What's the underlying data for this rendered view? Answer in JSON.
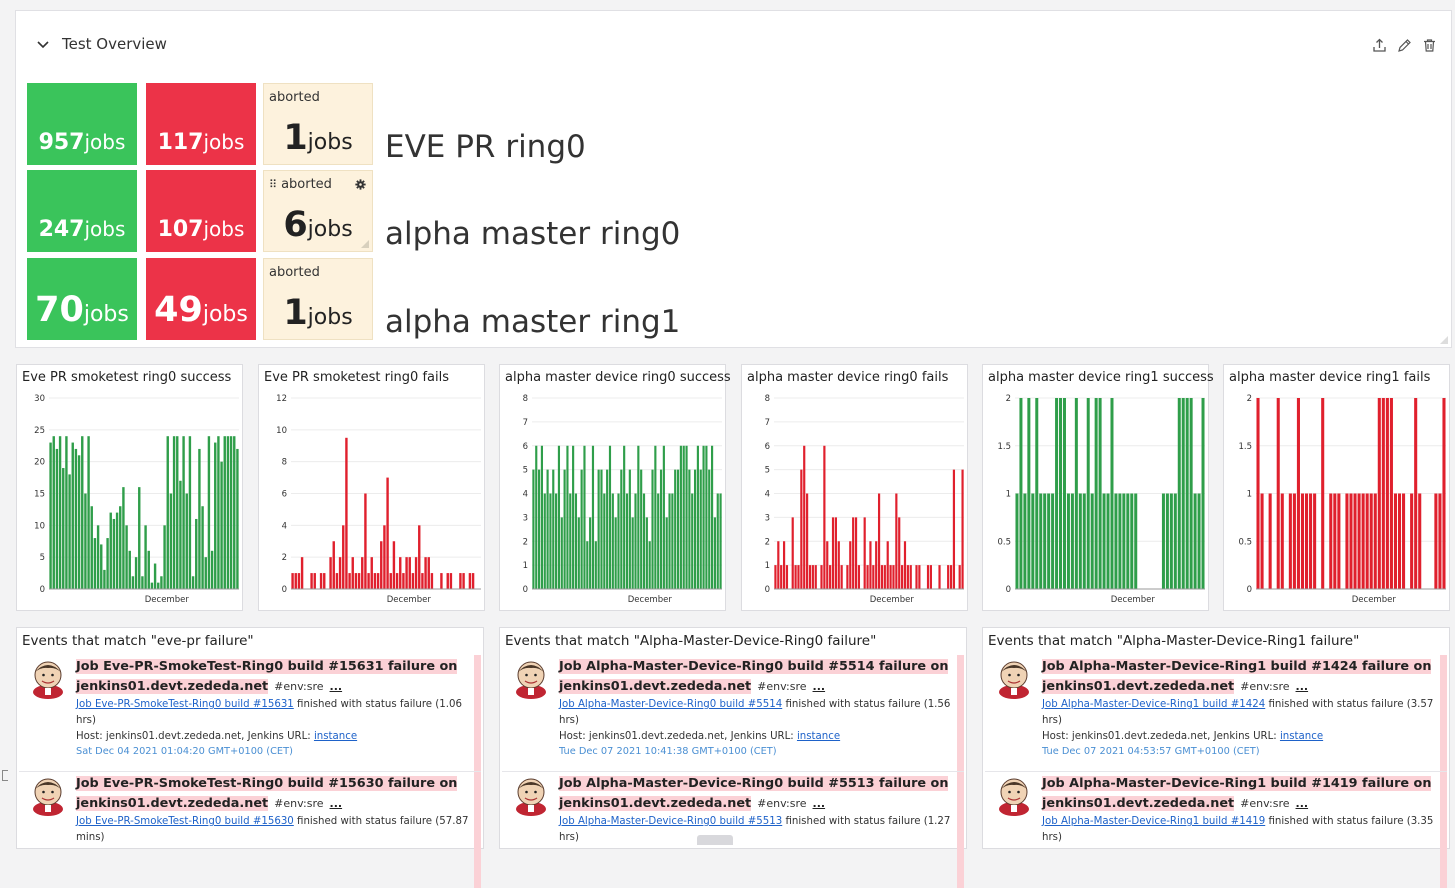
{
  "group": {
    "title": "Test Overview",
    "action_icons": [
      "export-icon",
      "edit-icon",
      "trash-icon"
    ]
  },
  "rows": [
    {
      "success": "957",
      "fails": "117",
      "aborted_label": "aborted",
      "aborted": "1",
      "unit": "jobs",
      "name": "EVE PR ring0"
    },
    {
      "success": "247",
      "fails": "107",
      "aborted_label": "aborted",
      "aborted": "6",
      "unit": "jobs",
      "name": "alpha master ring0"
    },
    {
      "success": "70",
      "fails": "49",
      "aborted_label": "aborted",
      "aborted": "1",
      "unit": "jobs",
      "name": "alpha master ring1"
    }
  ],
  "colors": {
    "success": "#3ac45b",
    "fail": "#ec3348",
    "aborted_bg": "#fdf2dd",
    "green_bar": "#2f9e4a",
    "red_bar": "#e0202d"
  },
  "chart_data": [
    {
      "type": "bar",
      "title": "Eve PR smoketest ring0 success",
      "ylim": [
        0,
        30
      ],
      "yticks": [
        0,
        5,
        10,
        15,
        20,
        25,
        30
      ],
      "x_tick": "December",
      "color": "#2f9e4a",
      "values": [
        23,
        24,
        22,
        24,
        19,
        24,
        18,
        23,
        22,
        21,
        24,
        15,
        24,
        13,
        8,
        10,
        7,
        3,
        8,
        12,
        11,
        12,
        13,
        16,
        10,
        6,
        2,
        5,
        16,
        2,
        10,
        6,
        1,
        4,
        1,
        2,
        10,
        24,
        15,
        24,
        24,
        17,
        24,
        15,
        24,
        2,
        11,
        22,
        13,
        5,
        24,
        6,
        23,
        24,
        20,
        24,
        24,
        24,
        24,
        22
      ]
    },
    {
      "type": "bar",
      "title": "Eve PR smoketest ring0 fails",
      "ylim": [
        0,
        12
      ],
      "yticks": [
        0,
        2,
        4,
        6,
        8,
        10,
        12
      ],
      "x_tick": "December",
      "color": "#e0202d",
      "values": [
        1,
        1,
        1,
        2,
        0,
        0,
        1,
        1,
        0,
        1,
        1,
        0,
        2,
        3,
        1,
        2,
        4,
        9.5,
        1,
        2,
        1,
        1,
        2,
        6,
        1,
        2,
        1,
        1,
        3,
        4,
        7,
        1,
        3,
        1,
        2,
        1,
        2,
        2,
        1,
        2,
        4,
        1,
        2,
        2,
        1,
        0,
        0,
        1,
        0,
        1,
        1,
        0,
        0,
        1,
        1,
        0,
        1,
        1,
        0,
        0
      ]
    },
    {
      "type": "bar",
      "title": "alpha master device ring0 success",
      "ylim": [
        0,
        8
      ],
      "yticks": [
        0,
        1,
        2,
        3,
        4,
        5,
        6,
        7,
        8
      ],
      "x_tick": "December",
      "color": "#2f9e4a",
      "values": [
        5,
        6,
        5,
        6,
        4,
        5,
        4,
        5,
        4,
        6,
        3,
        5,
        6,
        4,
        6,
        4,
        3,
        5,
        6,
        2,
        3,
        6,
        2,
        5,
        5,
        4,
        5,
        6,
        4,
        3,
        4,
        5,
        6,
        4,
        5,
        3,
        4,
        6,
        5,
        4,
        3,
        2,
        5,
        6,
        4,
        5,
        6,
        3,
        4,
        4,
        5,
        5,
        6,
        6,
        6,
        5,
        4,
        5,
        6,
        5,
        6,
        6,
        5,
        6,
        3,
        4,
        4
      ]
    },
    {
      "type": "bar",
      "title": "alpha master device ring0 fails",
      "ylim": [
        0,
        8
      ],
      "yticks": [
        0,
        1,
        2,
        3,
        4,
        5,
        6,
        7,
        8
      ],
      "x_tick": "December",
      "color": "#e0202d",
      "values": [
        1,
        2,
        1,
        2,
        1,
        0,
        3,
        1,
        1,
        5,
        6,
        4,
        1,
        1,
        1,
        0,
        1,
        6,
        2,
        1,
        3,
        3,
        2,
        1,
        0,
        1,
        2,
        3,
        3,
        1,
        0,
        3,
        1,
        2,
        1,
        2,
        4,
        1,
        1,
        2,
        1,
        1,
        4,
        3,
        1,
        2,
        1,
        1,
        0,
        1,
        1,
        0,
        0,
        1,
        1,
        0,
        0,
        1,
        0,
        0,
        1,
        1,
        5,
        0,
        1,
        5
      ]
    },
    {
      "type": "bar",
      "title": "alpha master device ring1 success",
      "ylim": [
        0,
        2
      ],
      "yticks": [
        0,
        0.5,
        1,
        1.5,
        2
      ],
      "x_tick": "December",
      "color": "#2f9e4a",
      "values": [
        1,
        2,
        1,
        2,
        1,
        2,
        1,
        1,
        1,
        1,
        2,
        2,
        2,
        1,
        1,
        2,
        1,
        1,
        2,
        1,
        2,
        2,
        1,
        1,
        2,
        1,
        1,
        1,
        1,
        1,
        1,
        0,
        0,
        0,
        0,
        0,
        0,
        1,
        1,
        1,
        1,
        2,
        2,
        2,
        2,
        1,
        1,
        2
      ]
    },
    {
      "type": "bar",
      "title": "alpha master device ring1 fails",
      "ylim": [
        0,
        2
      ],
      "yticks": [
        0,
        0.5,
        1,
        1.5,
        2
      ],
      "x_tick": "December",
      "color": "#e0202d",
      "values": [
        2,
        1,
        0,
        1,
        0,
        2,
        1,
        0,
        1,
        1,
        2,
        1,
        1,
        1,
        1,
        0,
        2,
        0,
        1,
        1,
        1,
        0,
        1,
        1,
        1,
        1,
        1,
        1,
        1,
        1,
        2,
        2,
        2,
        2,
        1,
        1,
        1,
        0,
        1,
        2,
        1,
        0,
        0,
        0,
        1,
        1,
        2
      ]
    }
  ],
  "events": [
    {
      "title": "Events that match \"eve-pr failure\"",
      "items": [
        {
          "job": "Job Eve-PR-SmokeTest-Ring0 build #15631 failure on",
          "host": "jenkins01.devt.zededa.net",
          "tag": "#env:sre",
          "more": "...",
          "link": "Job Eve-PR-SmokeTest-Ring0 build #15631",
          "status": " finished with status failure (1.06",
          "status2": "hrs)",
          "hostline": "Host: jenkins01.devt.zededa.net, Jenkins URL: ",
          "instance": "instance",
          "date": "Sat Dec 04 2021 01:04:20 GMT+0100 (CET)"
        },
        {
          "job": "Job Eve-PR-SmokeTest-Ring0 build #15630 failure on",
          "host": "jenkins01.devt.zededa.net",
          "tag": "#env:sre",
          "more": "...",
          "link": "Job Eve-PR-SmokeTest-Ring0 build #15630",
          "status": " finished with status failure (57.87",
          "status2": "mins)"
        }
      ]
    },
    {
      "title": "Events that match \"Alpha-Master-Device-Ring0 failure\"",
      "items": [
        {
          "job": "Job Alpha-Master-Device-Ring0 build #5514 failure on",
          "host": "jenkins01.devt.zededa.net",
          "tag": "#env:sre",
          "more": "...",
          "link": "Job Alpha-Master-Device-Ring0 build #5514",
          "status": " finished with status failure (1.56",
          "status2": "hrs)",
          "hostline": "Host: jenkins01.devt.zededa.net, Jenkins URL: ",
          "instance": "instance",
          "date": "Tue Dec 07 2021 10:41:38 GMT+0100 (CET)"
        },
        {
          "job": "Job Alpha-Master-Device-Ring0 build #5513 failure on",
          "host": "jenkins01.devt.zededa.net",
          "tag": "#env:sre",
          "more": "...",
          "link": "Job Alpha-Master-Device-Ring0 build #5513",
          "status": " finished with status failure (1.27",
          "status2": "hrs)"
        }
      ]
    },
    {
      "title": "Events that match \"Alpha-Master-Device-Ring1 failure\"",
      "items": [
        {
          "job": "Job Alpha-Master-Device-Ring1 build #1424 failure on",
          "host": "jenkins01.devt.zededa.net",
          "tag": "#env:sre",
          "more": "...",
          "link": "Job Alpha-Master-Device-Ring1 build #1424",
          "status": " finished with status failure (3.57",
          "status2": "hrs)",
          "hostline": "Host: jenkins01.devt.zededa.net, Jenkins URL: ",
          "instance": "instance",
          "date": "Tue Dec 07 2021 04:53:57 GMT+0100 (CET)"
        },
        {
          "job": "Job Alpha-Master-Device-Ring1 build #1419 failure on",
          "host": "jenkins01.devt.zededa.net",
          "tag": "#env:sre",
          "more": "...",
          "link": "Job Alpha-Master-Device-Ring1 build #1419",
          "status": " finished with status failure (3.35",
          "status2": "hrs)"
        }
      ]
    }
  ]
}
